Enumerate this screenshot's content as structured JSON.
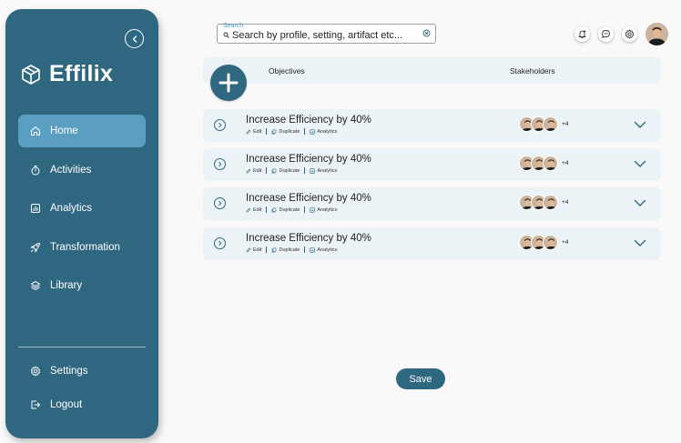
{
  "app": {
    "name": "Effilix"
  },
  "sidebar": {
    "nav": [
      {
        "label": "Home",
        "icon": "home-icon",
        "active": true
      },
      {
        "label": "Activities",
        "icon": "stopwatch-icon",
        "active": false
      },
      {
        "label": "Analytics",
        "icon": "analytics-icon",
        "active": false
      },
      {
        "label": "Transformation",
        "icon": "rocket-icon",
        "active": false
      },
      {
        "label": "Library",
        "icon": "layers-icon",
        "active": false
      }
    ],
    "bottom": [
      {
        "label": "Settings",
        "icon": "gear-icon"
      },
      {
        "label": "Logout",
        "icon": "logout-icon"
      }
    ]
  },
  "search": {
    "label": "Search",
    "value": "Search by profile, setting, artifact etc..."
  },
  "table": {
    "columns": {
      "objectives": "Objectives",
      "stakeholders": "Stakeholders"
    },
    "rows": [
      {
        "title": "Increase Efficiency by 40%",
        "more": "+4"
      },
      {
        "title": "Increase Efficiency by 40%",
        "more": "+4"
      },
      {
        "title": "Increase Efficiency by 40%",
        "more": "+4"
      },
      {
        "title": "Increase Efficiency by 40%",
        "more": "+4"
      }
    ],
    "actions": {
      "edit": "Edit",
      "duplicate": "Duplicate",
      "analytics": "Analytics"
    }
  },
  "save_label": "Save",
  "colors": {
    "primary": "#2f6680",
    "active": "#5a9fc2",
    "row_bg": "#ecf3f7"
  }
}
